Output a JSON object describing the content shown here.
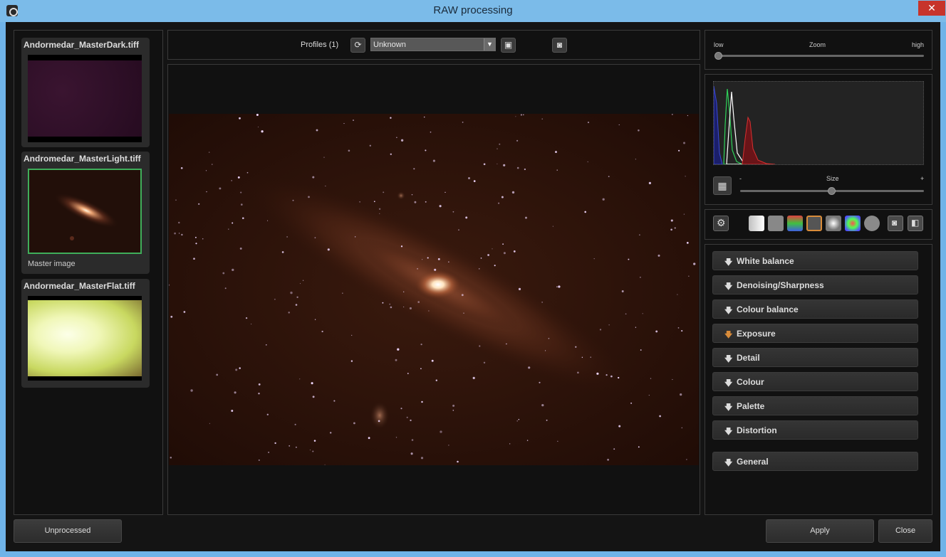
{
  "window": {
    "title": "RAW processing",
    "close_glyph": "✕"
  },
  "thumbnails": [
    {
      "name": "Andormedar_MasterDark.tiff"
    },
    {
      "name": "Andromedar_MasterLight.tiff",
      "sublabel": "Master image"
    },
    {
      "name": "Andormedar_MasterFlat.tiff"
    }
  ],
  "toolbar": {
    "profiles_label": "Profiles (1)",
    "profile_value": "Unknown"
  },
  "zoom": {
    "label": "Zoom",
    "low": "low",
    "high": "high",
    "value": 0
  },
  "histogram": {
    "size_label": "Size",
    "minus": "-",
    "plus": "+",
    "size_value": 0.5
  },
  "sections": [
    {
      "label": "White balance",
      "highlighted": false
    },
    {
      "label": "Denoising/Sharpness",
      "highlighted": false
    },
    {
      "label": "Colour balance",
      "highlighted": false
    },
    {
      "label": "Exposure",
      "highlighted": true
    },
    {
      "label": "Detail",
      "highlighted": false
    },
    {
      "label": "Colour",
      "highlighted": false
    },
    {
      "label": "Palette",
      "highlighted": false
    },
    {
      "label": "Distortion",
      "highlighted": false
    },
    {
      "label": "General",
      "highlighted": false
    }
  ],
  "footer": {
    "unprocessed": "Unprocessed",
    "apply": "Apply",
    "close": "Close"
  },
  "colors": {
    "titlebar": "#7bbbe9",
    "accent_green": "#3fae5a",
    "close_red": "#c7342b",
    "exposure_arrow": "#d98c3a"
  }
}
